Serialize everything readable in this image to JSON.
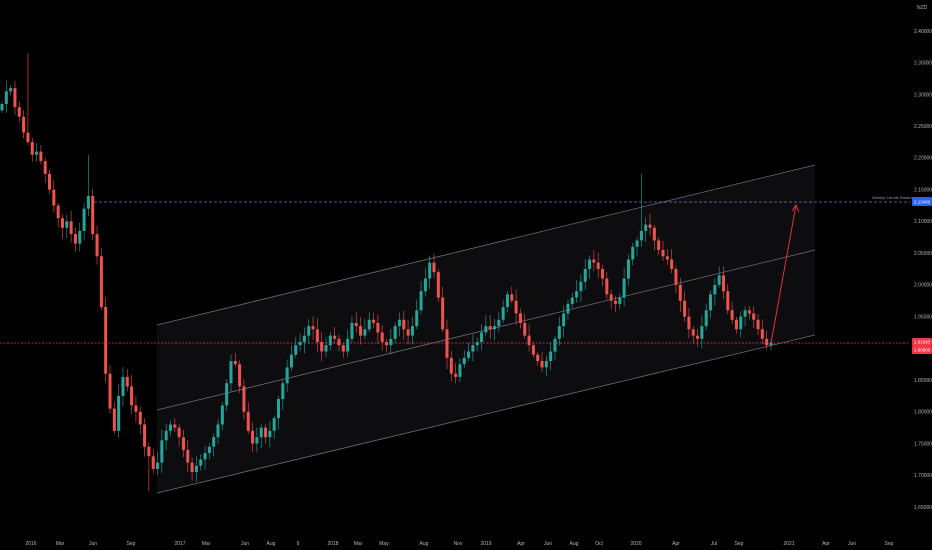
{
  "chart_data": {
    "type": "candlestick",
    "title": "",
    "currency_label": "NZD",
    "x_ticks": [
      "2016",
      "Mar",
      "Jun",
      "Sep",
      "2017",
      "Mar",
      "Jun",
      "Aug",
      "9",
      "2018",
      "Mar",
      "May",
      "Aug",
      "Nov",
      "2019",
      "Apr",
      "Jun",
      "Aug",
      "Oct",
      "2020",
      "Apr",
      "Jul",
      "Sep",
      "2021",
      "Apr",
      "Jun",
      "Sep"
    ],
    "y_ticks": [
      "2.40000",
      "2.35000",
      "2.30000",
      "2.25000",
      "2.20000",
      "2.15000",
      "2.10000",
      "2.05000",
      "2.00000",
      "1.95000",
      "1.90000",
      "1.85000",
      "1.80000",
      "1.75000",
      "1.70000",
      "1.65000"
    ],
    "ylim": [
      1.63,
      2.42
    ],
    "grid": false,
    "colors": {
      "up": "#26a69a",
      "down": "#ef5350",
      "background": "#000000",
      "channel": "#787b86",
      "breakout": "#6f7bd6",
      "support": "#f23645"
    },
    "prices": [
      2.285,
      2.305,
      2.31,
      2.28,
      2.265,
      2.24,
      2.225,
      2.205,
      2.21,
      2.195,
      2.175,
      2.15,
      2.125,
      2.105,
      2.09,
      2.1,
      2.08,
      2.065,
      2.085,
      2.12,
      2.14,
      2.08,
      2.045,
      1.965,
      1.86,
      1.805,
      1.77,
      1.825,
      1.855,
      1.84,
      1.81,
      1.8,
      1.78,
      1.745,
      1.73,
      1.71,
      1.72,
      1.755,
      1.77,
      1.78,
      1.775,
      1.76,
      1.74,
      1.72,
      1.705,
      1.715,
      1.725,
      1.735,
      1.745,
      1.76,
      1.78,
      1.81,
      1.845,
      1.88,
      1.875,
      1.84,
      1.8,
      1.77,
      1.75,
      1.76,
      1.775,
      1.76,
      1.77,
      1.79,
      1.82,
      1.845,
      1.87,
      1.89,
      1.905,
      1.91,
      1.92,
      1.935,
      1.93,
      1.91,
      1.895,
      1.905,
      1.92,
      1.915,
      1.905,
      1.895,
      1.915,
      1.94,
      1.935,
      1.92,
      1.93,
      1.945,
      1.94,
      1.925,
      1.91,
      1.905,
      1.915,
      1.935,
      1.945,
      1.93,
      1.92,
      1.935,
      1.96,
      1.99,
      2.01,
      2.035,
      2.02,
      1.98,
      1.93,
      1.885,
      1.86,
      1.855,
      1.875,
      1.885,
      1.895,
      1.905,
      1.91,
      1.925,
      1.935,
      1.93,
      1.935,
      1.945,
      1.965,
      1.985,
      1.975,
      1.955,
      1.94,
      1.92,
      1.905,
      1.89,
      1.88,
      1.87,
      1.88,
      1.895,
      1.915,
      1.935,
      1.955,
      1.97,
      1.98,
      1.99,
      2.005,
      2.025,
      2.04,
      2.035,
      2.025,
      2.01,
      1.985,
      1.975,
      1.97,
      1.98,
      2.01,
      2.04,
      2.06,
      2.07,
      2.085,
      2.095,
      2.09,
      2.07,
      2.055,
      2.045,
      2.04,
      2.025,
      2.0,
      1.975,
      1.95,
      1.93,
      1.92,
      1.915,
      1.935,
      1.96,
      1.985,
      2.0,
      2.015,
      1.99,
      1.96,
      1.945,
      1.93,
      1.95,
      1.96,
      1.955,
      1.945,
      1.93,
      1.915,
      1.905,
      1.909
    ],
    "annotations": {
      "breakout_label": "Weekly Candle Breakout",
      "breakout_price": "2.13480",
      "support_price_1": "1.91093",
      "support_price_2": "1.90900",
      "breakout_level": 2.1348,
      "support_level": 1.9109,
      "projection_target": 2.125
    }
  }
}
